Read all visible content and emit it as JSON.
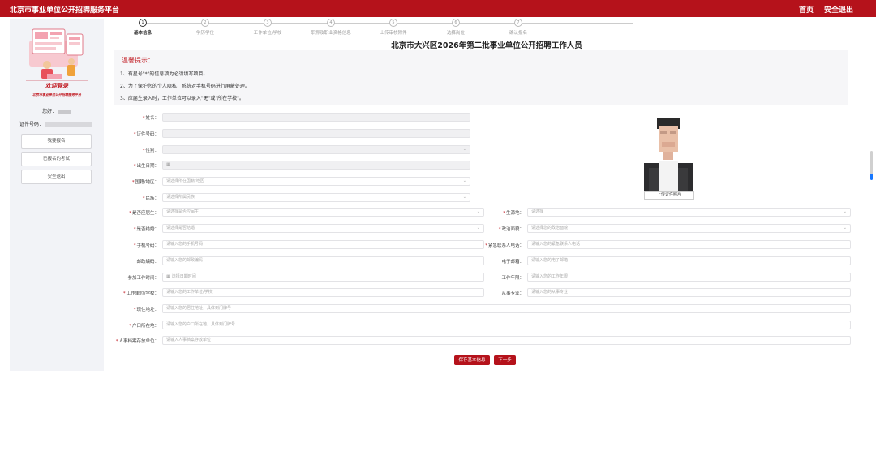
{
  "header": {
    "title": "北京市事业单位公开招聘服务平台",
    "home": "首页",
    "logout": "安全退出",
    "brand_color": "#b5121b"
  },
  "sidebar": {
    "welcome": "欢迎登录",
    "welcome_sub": "北京市事业单位公开招聘服务平台",
    "greeting_label": "您好：",
    "id_label": "证件号码：",
    "buttons": [
      "我要报名",
      "已报名的考试",
      "安全退出"
    ]
  },
  "steps": [
    {
      "num": "1",
      "label": "基本信息",
      "active": true
    },
    {
      "num": "2",
      "label": "学历学位",
      "active": false
    },
    {
      "num": "3",
      "label": "工作单位/学校",
      "active": false
    },
    {
      "num": "4",
      "label": "职称及职业资格信息",
      "active": false
    },
    {
      "num": "5",
      "label": "上传审核附件",
      "active": false
    },
    {
      "num": "6",
      "label": "选择岗位",
      "active": false
    },
    {
      "num": "7",
      "label": "确认报名",
      "active": false
    }
  ],
  "page_title": "北京市大兴区2026年第二批事业单位公开招聘工作人员",
  "notice": {
    "title": "温馨提示：",
    "lines": [
      "1、有星号\"*\"的信息项为必须填写项目。",
      "2、为了保护您的个人隐私，系统对手机号码进行屏蔽处理。",
      "3、应届生录入时，工作单位可以录入\"无\"或\"所在学校\"。"
    ]
  },
  "form": {
    "name_label": "姓名：",
    "id_label": "证件号码：",
    "gender_label": "性别：",
    "birth_label": "出生日期：",
    "nation_label": "国籍/地区：",
    "nation_ph": "请选择所在国籍/地区",
    "ethnic_label": "民族：",
    "ethnic_ph": "请选择所属民族",
    "fresh_label": "是否应届生：",
    "fresh_ph": "请选择是否应届生",
    "origin_label": "生源地：",
    "origin_ph": "请选择",
    "married_label": "是否结婚：",
    "married_ph": "请选择是否结婚",
    "political_label": "政治面貌：",
    "political_ph": "请选择您的政治面貌",
    "phone_label": "手机号码：",
    "phone_ph": "请输入您的手机号码",
    "emergency_label": "紧急联系人电话：",
    "emergency_ph": "请输入您的紧急联系人电话",
    "postal_label": "邮政编码：",
    "postal_ph": "请输入您的邮政编码",
    "email_label": "电子邮箱：",
    "email_ph": "请输入您的电子邮箱",
    "firstjob_label": "参加工作时间：",
    "firstjob_ph": "选择日期时间",
    "years_label": "工作年限：",
    "years_ph": "请输入您的工作年限",
    "unit_label": "工作单位/学校：",
    "unit_ph": "请输入您的工作单位/学校",
    "major_label": "从事专业：",
    "major_ph": "请输入您的从事专业",
    "addr_label": "现住地址：",
    "addr_ph": "请输入您的居住地址，具体到门牌号",
    "hukou_label": "户口所在地：",
    "hukou_ph": "请输入您的户口所在地，具体到门牌号",
    "archive_label": "人事档案存放单位：",
    "archive_ph": "请输入人事档案存放单位"
  },
  "photo_button": "上传证件照片",
  "actions": {
    "save": "保存基本信息",
    "next": "下一步"
  }
}
